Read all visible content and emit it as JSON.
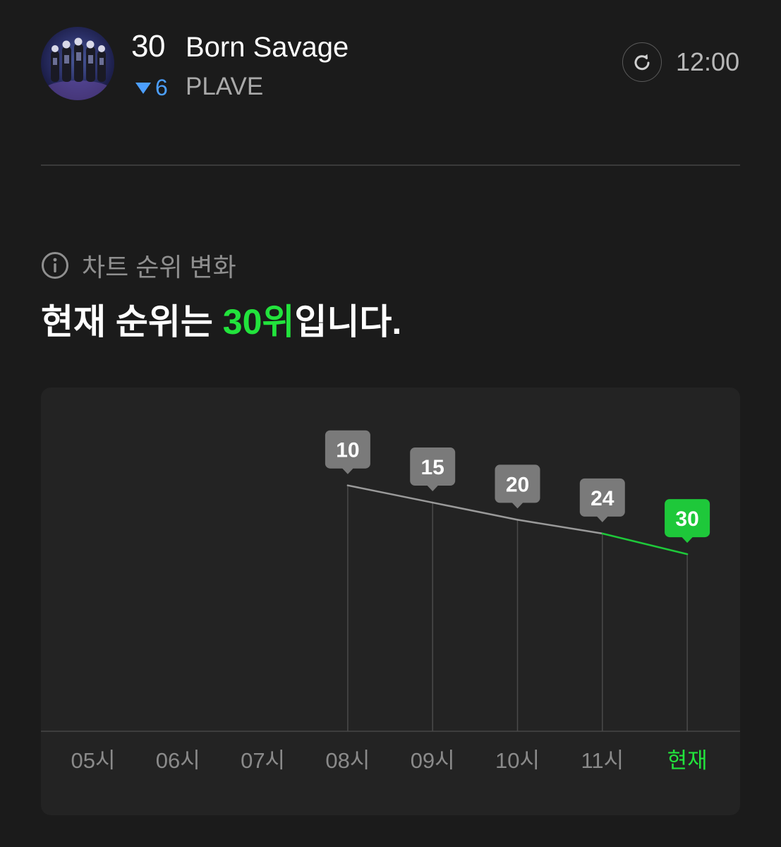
{
  "song": {
    "rank": "30",
    "title": "Born Savage",
    "artist": "PLAVE",
    "change_value": "6",
    "change_direction": "down"
  },
  "header": {
    "time": "12:00",
    "refresh_icon": "refresh-icon"
  },
  "section": {
    "label": "차트 순위 변화",
    "icon": "info-icon"
  },
  "headline": {
    "prefix": "현재 순위는 ",
    "highlight": "30위",
    "suffix": "입니다."
  },
  "colors": {
    "accent_green": "#22e33c",
    "marker_green": "#1ec83a",
    "down_blue": "#4c9fff",
    "marker_gray": "#7a7a7a",
    "line_gray": "#9a9a9a"
  },
  "chart_data": {
    "type": "line",
    "categories": [
      "05시",
      "06시",
      "07시",
      "08시",
      "09시",
      "10시",
      "11시",
      "현재"
    ],
    "values": [
      null,
      null,
      null,
      10,
      15,
      20,
      24,
      30
    ],
    "labels": [
      "",
      "",
      "",
      "10",
      "15",
      "20",
      "24",
      "30"
    ],
    "highlight_index": 7,
    "y_inverted": true,
    "ylim": [
      0,
      100
    ]
  }
}
